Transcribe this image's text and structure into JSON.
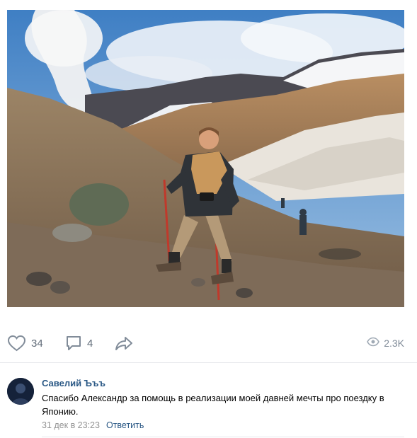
{
  "post": {
    "photo_alt": "",
    "likes": "34",
    "comments": "4",
    "views": "2.3K"
  },
  "icons": {
    "like": "heart-icon",
    "comment": "comment-bubble-icon",
    "share": "share-arrow-icon",
    "views": "eye-icon"
  },
  "colors": {
    "icon_gray": "#818c99",
    "link_blue": "#2a5885",
    "divider": "#e7e8ec"
  },
  "comment": {
    "author": "Савелий Ъъъ",
    "text": "Спасибо Александр за помощь в реализации моей давней мечты про поездку в Японию.",
    "date": "31 дек в 23:23",
    "reply_label": "Ответить"
  }
}
